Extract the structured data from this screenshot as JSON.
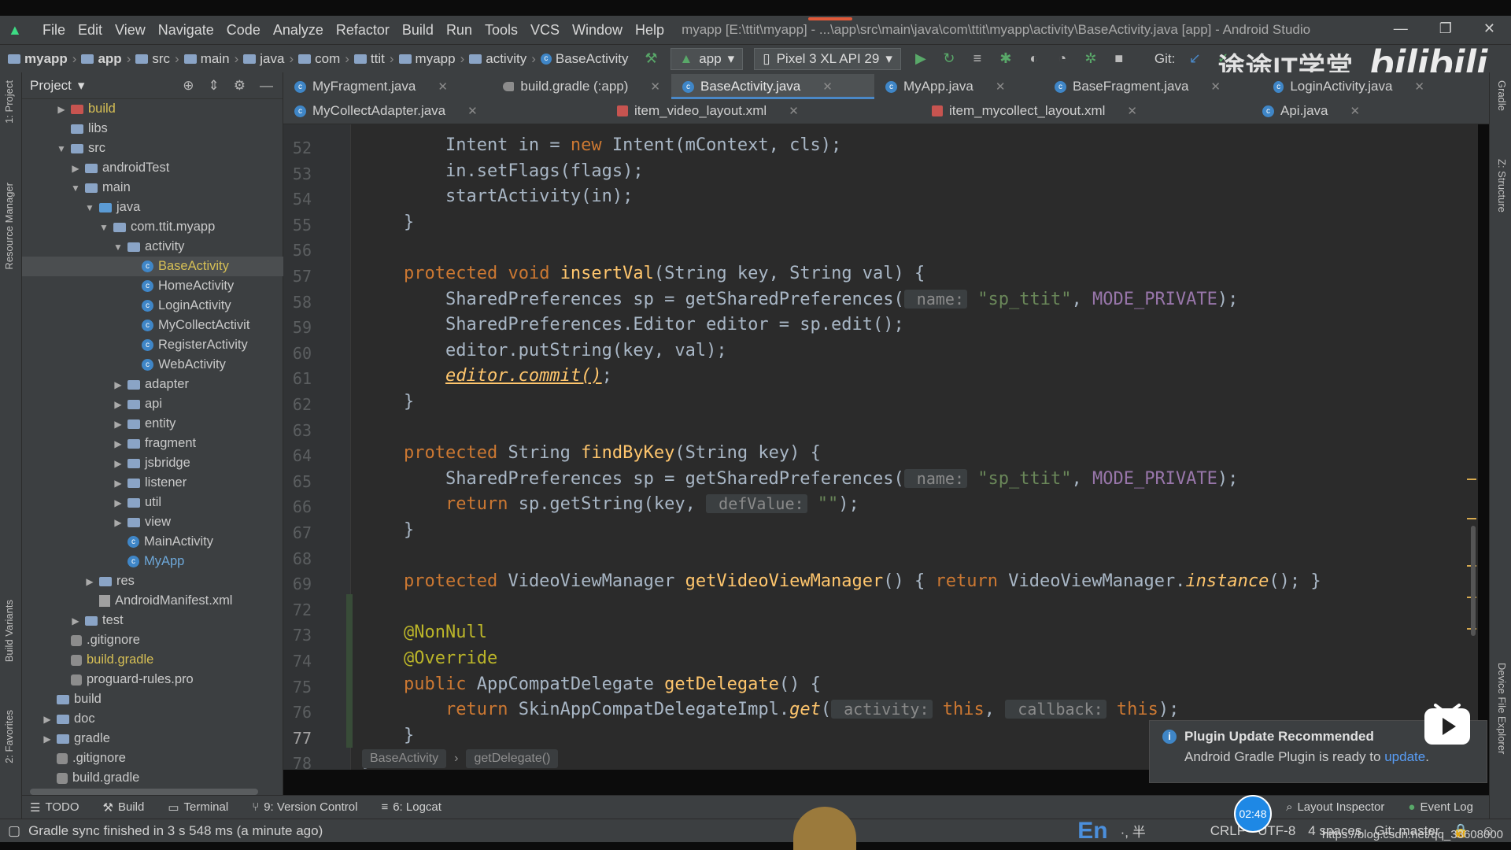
{
  "window": {
    "title": "myapp [E:\\ttit\\myapp] - ...\\app\\src\\main\\java\\com\\ttit\\myapp\\activity\\BaseActivity.java [app] - Android Studio",
    "controls": [
      "—",
      "❐",
      "✕"
    ]
  },
  "menu": [
    "File",
    "Edit",
    "View",
    "Navigate",
    "Code",
    "Analyze",
    "Refactor",
    "Build",
    "Run",
    "Tools",
    "VCS",
    "Window",
    "Help"
  ],
  "breadcrumbs": [
    "myapp",
    "app",
    "src",
    "main",
    "java",
    "com",
    "ttit",
    "myapp",
    "activity",
    "BaseActivity"
  ],
  "toolbar": {
    "run_config": "app",
    "device": "Pixel 3 XL API 29",
    "git_label": "Git:"
  },
  "watermark": {
    "text": "途途IT学堂",
    "logo": "bilibili"
  },
  "project_panel": {
    "title": "Project",
    "tree": [
      {
        "label": "build",
        "depth": 2,
        "arrow": "▶",
        "icon": "folder-brown",
        "style": "hl"
      },
      {
        "label": "libs",
        "depth": 2,
        "arrow": "",
        "icon": "folder"
      },
      {
        "label": "src",
        "depth": 2,
        "arrow": "▼",
        "icon": "folder"
      },
      {
        "label": "androidTest",
        "depth": 3,
        "arrow": "▶",
        "icon": "folder"
      },
      {
        "label": "main",
        "depth": 3,
        "arrow": "▼",
        "icon": "folder"
      },
      {
        "label": "java",
        "depth": 4,
        "arrow": "▼",
        "icon": "folder-src"
      },
      {
        "label": "com.ttit.myapp",
        "depth": 5,
        "arrow": "▼",
        "icon": "folder"
      },
      {
        "label": "activity",
        "depth": 6,
        "arrow": "▼",
        "icon": "folder"
      },
      {
        "label": "BaseActivity",
        "depth": 7,
        "arrow": "",
        "icon": "class",
        "selected": true,
        "style": "hl"
      },
      {
        "label": "HomeActivity",
        "depth": 7,
        "arrow": "",
        "icon": "class"
      },
      {
        "label": "LoginActivity",
        "depth": 7,
        "arrow": "",
        "icon": "class"
      },
      {
        "label": "MyCollectActivit",
        "depth": 7,
        "arrow": "",
        "icon": "class"
      },
      {
        "label": "RegisterActivity",
        "depth": 7,
        "arrow": "",
        "icon": "class"
      },
      {
        "label": "WebActivity",
        "depth": 7,
        "arrow": "",
        "icon": "class"
      },
      {
        "label": "adapter",
        "depth": 6,
        "arrow": "▶",
        "icon": "folder"
      },
      {
        "label": "api",
        "depth": 6,
        "arrow": "▶",
        "icon": "folder"
      },
      {
        "label": "entity",
        "depth": 6,
        "arrow": "▶",
        "icon": "folder"
      },
      {
        "label": "fragment",
        "depth": 6,
        "arrow": "▶",
        "icon": "folder"
      },
      {
        "label": "jsbridge",
        "depth": 6,
        "arrow": "▶",
        "icon": "folder"
      },
      {
        "label": "listener",
        "depth": 6,
        "arrow": "▶",
        "icon": "folder"
      },
      {
        "label": "util",
        "depth": 6,
        "arrow": "▶",
        "icon": "folder"
      },
      {
        "label": "view",
        "depth": 6,
        "arrow": "▶",
        "icon": "folder"
      },
      {
        "label": "MainActivity",
        "depth": 6,
        "arrow": "",
        "icon": "class"
      },
      {
        "label": "MyApp",
        "depth": 6,
        "arrow": "",
        "icon": "class",
        "style": "blue"
      },
      {
        "label": "res",
        "depth": 4,
        "arrow": "▶",
        "icon": "folder"
      },
      {
        "label": "AndroidManifest.xml",
        "depth": 4,
        "arrow": "",
        "icon": "xml"
      },
      {
        "label": "test",
        "depth": 3,
        "arrow": "▶",
        "icon": "folder"
      },
      {
        "label": ".gitignore",
        "depth": 2,
        "arrow": "",
        "icon": "file"
      },
      {
        "label": "build.gradle",
        "depth": 2,
        "arrow": "",
        "icon": "gradle",
        "style": "yellow"
      },
      {
        "label": "proguard-rules.pro",
        "depth": 2,
        "arrow": "",
        "icon": "file"
      },
      {
        "label": "build",
        "depth": 1,
        "arrow": "",
        "icon": "folder"
      },
      {
        "label": "doc",
        "depth": 1,
        "arrow": "▶",
        "icon": "folder"
      },
      {
        "label": "gradle",
        "depth": 1,
        "arrow": "▶",
        "icon": "folder"
      },
      {
        "label": ".gitignore",
        "depth": 1,
        "arrow": "",
        "icon": "file"
      },
      {
        "label": "build.gradle",
        "depth": 1,
        "arrow": "",
        "icon": "gradle"
      }
    ]
  },
  "tabs_row1": [
    {
      "label": "MyFragment.java",
      "icon": "class",
      "active": false
    },
    {
      "label": "build.gradle (:app)",
      "icon": "gradle",
      "active": false
    },
    {
      "label": "BaseActivity.java",
      "icon": "class",
      "active": true
    },
    {
      "label": "MyApp.java",
      "icon": "class",
      "active": false
    },
    {
      "label": "BaseFragment.java",
      "icon": "class",
      "active": false
    },
    {
      "label": "LoginActivity.java",
      "icon": "class",
      "active": false
    }
  ],
  "tabs_row2": [
    {
      "label": "MyCollectAdapter.java",
      "icon": "class"
    },
    {
      "label": "item_video_layout.xml",
      "icon": "xml"
    },
    {
      "label": "item_mycollect_layout.xml",
      "icon": "xml"
    },
    {
      "label": "Api.java",
      "icon": "class"
    }
  ],
  "editor": {
    "line_numbers": [
      "52",
      "53",
      "54",
      "55",
      "56",
      "57",
      "58",
      "59",
      "60",
      "61",
      "62",
      "63",
      "64",
      "65",
      "66",
      "67",
      "68",
      "69",
      "72",
      "73",
      "74",
      "75",
      "76",
      "77",
      "78"
    ],
    "current_line": "77",
    "code_lines": [
      "        Intent in = new Intent(mContext, cls);",
      "        in.setFlags(flags);",
      "        startActivity(in);",
      "    }",
      "",
      "    protected void insertVal(String key, String val) {",
      "        SharedPreferences sp = getSharedPreferences( name: \"sp_ttit\", MODE_PRIVATE);",
      "        SharedPreferences.Editor editor = sp.edit();",
      "        editor.putString(key, val);",
      "        editor.commit();",
      "    }",
      "",
      "    protected String findByKey(String key) {",
      "        SharedPreferences sp = getSharedPreferences( name: \"sp_ttit\", MODE_PRIVATE);",
      "        return sp.getString(key,  defValue: \"\");",
      "    }",
      "",
      "    protected VideoViewManager getVideoViewManager() { return VideoViewManager.instance(); }",
      "",
      "    @NonNull",
      "    @Override",
      "    public AppCompatDelegate getDelegate() {",
      "        return SkinAppCompatDelegateImpl.get( activity: this,  callback: this);",
      "    }",
      "}"
    ],
    "breadcrumb": [
      "BaseActivity",
      "getDelegate()"
    ]
  },
  "notification": {
    "title": "Plugin Update Recommended",
    "body": "Android Gradle Plugin is ready to",
    "link": "update",
    "tail": "."
  },
  "bottom_tools": {
    "left": [
      "TODO",
      "Build",
      "Terminal",
      "9: Version Control",
      "6: Logcat"
    ],
    "right": [
      "Layout Inspector",
      "Event Log"
    ]
  },
  "status": {
    "message": "Gradle sync finished in 3 s 548 ms (a minute ago)",
    "ime": "En",
    "ime_extra": "·, 半",
    "line_sep": "CRLF",
    "encoding": "UTF-8",
    "indent": "4 spaces",
    "git": "Git: master",
    "clock": "02:48",
    "url": "https://blog.csdn.net/qq_33608000"
  },
  "side_labels": {
    "left_top": "1: Project",
    "left_mid": "Resource Manager",
    "left_bottom1": "Build Variants",
    "left_bottom2": "2: Favorites",
    "right_top": "Gradle",
    "right_mid": "Z: Structure",
    "right_bottom": "Device File Explorer"
  }
}
